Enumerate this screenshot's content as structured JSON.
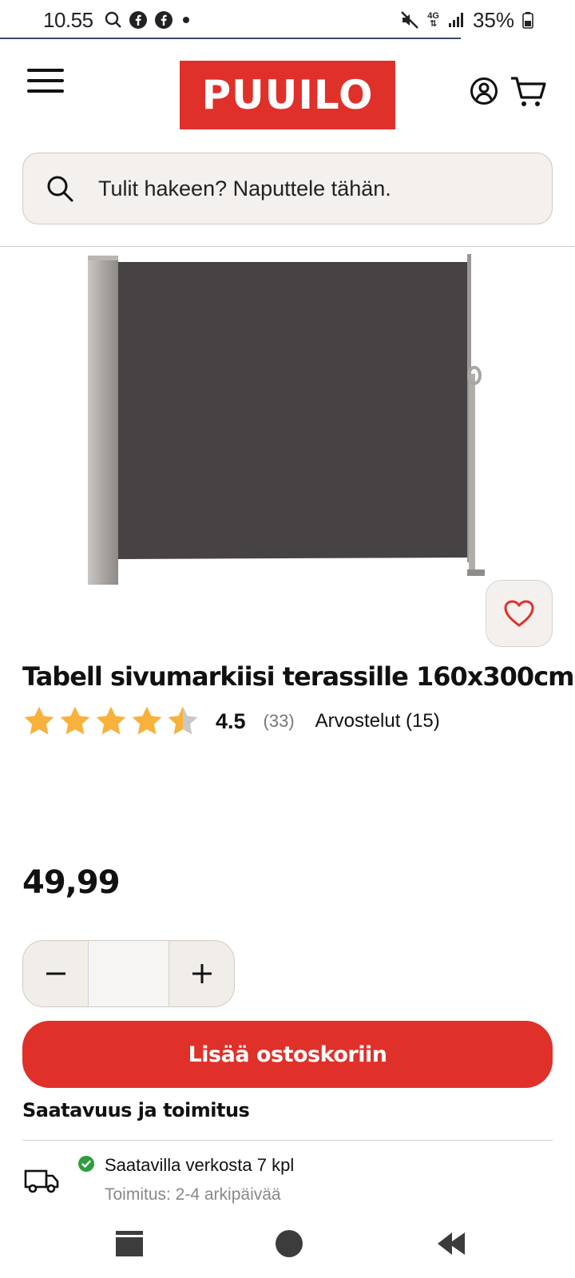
{
  "status_bar": {
    "time": "10.55",
    "network": "4G",
    "battery": "35%"
  },
  "header": {
    "logo": "PUUILO"
  },
  "search": {
    "placeholder": "Tulit hakeen? Naputtele tähän."
  },
  "product": {
    "title": "Tabell sivumarkiisi terassille 160x300cm",
    "rating": "4.5",
    "rating_count": "(33)",
    "reviews_link": "Arvostelut (15)",
    "price": "49,99",
    "quantity": "",
    "add_to_cart": "Lisää ostoskoriin"
  },
  "availability": {
    "heading": "Saatavuus ja toimitus",
    "stock": "Saatavilla verkosta 7 kpl",
    "delivery": "Toimitus: 2-4 arkipäivää"
  },
  "colors": {
    "brand_red": "#e0302a",
    "star": "#f8b13a",
    "in_stock": "#2e9e3e"
  }
}
